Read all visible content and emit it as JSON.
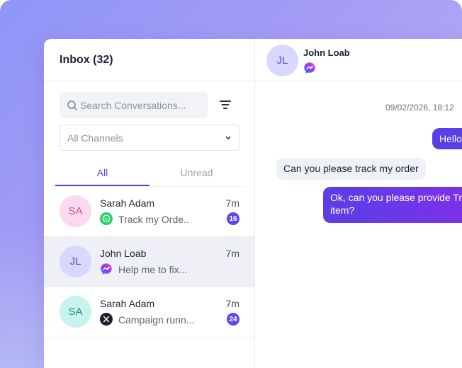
{
  "inbox": {
    "title": "Inbox (32)"
  },
  "search": {
    "placeholder": "Search Conversations..."
  },
  "channel_filter": {
    "selected": "All Channels"
  },
  "tabs": [
    {
      "label": "All",
      "active": true
    },
    {
      "label": "Unread",
      "active": false
    }
  ],
  "conversations": [
    {
      "initials": "SA",
      "name": "Sarah Adam",
      "time": "7m",
      "preview": "Track my Orde..",
      "channel_icon": "whatsapp-icon",
      "unread": "16",
      "avatar_bg": "#fbd9ef",
      "avatar_fg": "#c0569a"
    },
    {
      "initials": "JL",
      "name": "John Loab",
      "time": "7m",
      "preview": "Help me to fix...",
      "channel_icon": "messenger-icon",
      "unread": "",
      "avatar_bg": "#d7d8fb",
      "avatar_fg": "#5546e6"
    },
    {
      "initials": "SA",
      "name": "Sarah Adam",
      "time": "7m",
      "preview": "Campaign runn...",
      "channel_icon": "x-icon",
      "unread": "24",
      "avatar_bg": "#c7f3ee",
      "avatar_fg": "#2d8a80"
    }
  ],
  "chat": {
    "contact_initials": "JL",
    "contact_name": "John Loab",
    "channel_icon": "messenger-icon",
    "timestamp": "09/02/2026, 18:12",
    "messages": [
      {
        "direction": "outgoing",
        "text": "Hello,"
      },
      {
        "direction": "incoming",
        "text": "Can you please track my order"
      },
      {
        "direction": "outgoing",
        "text": "Ok, can you please provide Tra\nitem?"
      }
    ]
  },
  "colors": {
    "accent": "#5546e6",
    "badge": "#5a4be8",
    "selected_row": "#eef0f5",
    "outgoing_bubble": "#5a3ee8",
    "incoming_bubble": "#eef1f6"
  }
}
